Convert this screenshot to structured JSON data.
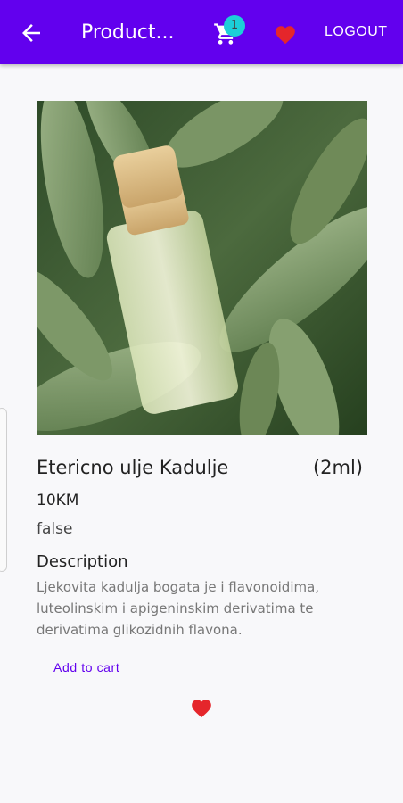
{
  "appbar": {
    "title": "Product...",
    "cart_count": "1",
    "logout_label": "LOGOUT"
  },
  "product": {
    "name": "Etericno ulje Kadulje",
    "size": "(2ml)",
    "price": "10KM",
    "flag": "false",
    "description_heading": "Description",
    "description": "Ljekovita kadulja bogata je i flavonoidima, luteolinskim i apigeninskim derivatima te derivatima glikozidnih flavona."
  },
  "actions": {
    "add_to_cart_label": "Add to cart"
  },
  "colors": {
    "primary": "#6200ee",
    "badge": "#1ccfd8",
    "heart": "#e5262b"
  }
}
